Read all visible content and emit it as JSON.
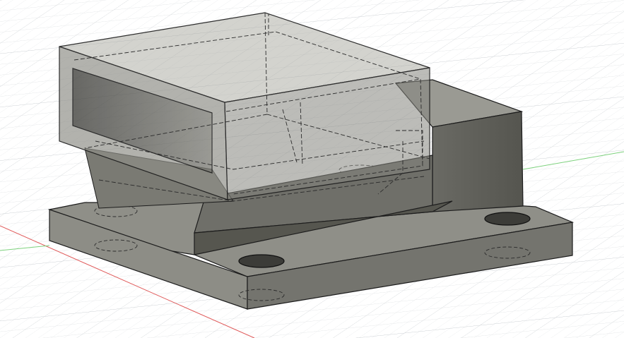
{
  "viewport": {
    "background": "#ffffff",
    "grid_minor_color": "#e6e8ea",
    "grid_major_color": "#cfd3d7"
  },
  "axes": {
    "x_axis_color": "#e05a5a",
    "y_axis_color": "#6bcf6b"
  },
  "model": {
    "body_color": "#8a8a82",
    "edge_color": "#1c1c1c",
    "hidden_edge_color": "#2b2b2b"
  }
}
